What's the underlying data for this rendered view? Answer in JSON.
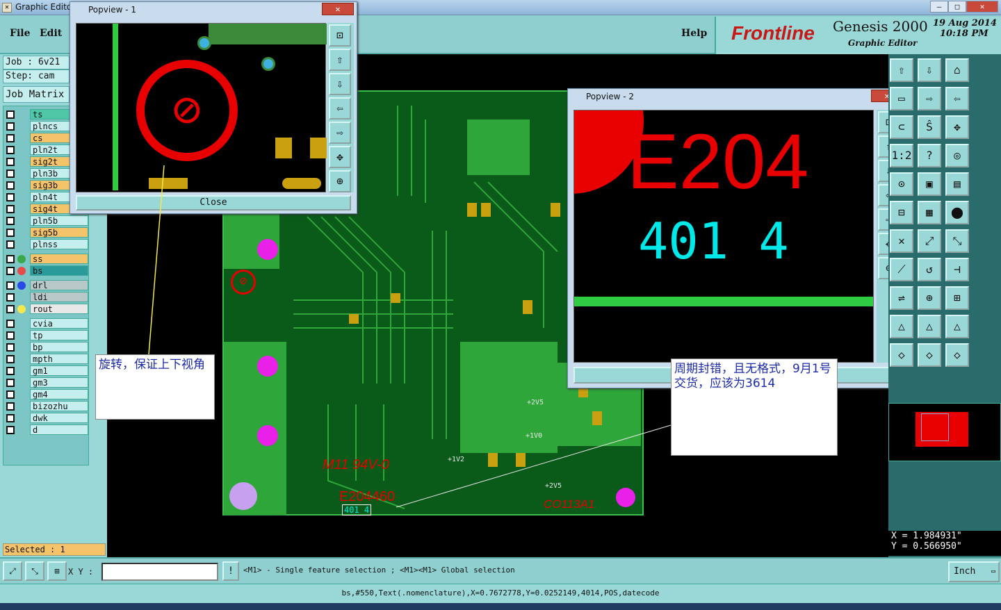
{
  "window": {
    "title": "Graphic Editor",
    "btn_min": "—",
    "btn_max": "□",
    "btn_close": "✕"
  },
  "menu": {
    "file": "File",
    "edit": "Edit",
    "help": "Help"
  },
  "brand": {
    "logo": "Frontline",
    "product": "Genesis 2000",
    "subtitle": "Graphic Editor",
    "date": "19 Aug 2014",
    "time": "10:18 PM"
  },
  "job": {
    "job_label": "Job : 6v21",
    "step_label": "Step: cam",
    "matrix_label": "Job Matrix"
  },
  "layers": [
    {
      "name": "ts",
      "color": "#4fc8a8"
    },
    {
      "name": "plncs",
      "color": "#c5efef"
    },
    {
      "name": "cs",
      "color": "#f5c46a"
    },
    {
      "name": "pln2t",
      "color": "#c5efef"
    },
    {
      "name": "sig2t",
      "color": "#f5c46a"
    },
    {
      "name": "pln3b",
      "color": "#c5efef"
    },
    {
      "name": "sig3b",
      "color": "#f5c46a"
    },
    {
      "name": "pln4t",
      "color": "#c5efef"
    },
    {
      "name": "sig4t",
      "color": "#f5c46a"
    },
    {
      "name": "pln5b",
      "color": "#c5efef"
    },
    {
      "name": "sig5b",
      "color": "#f5c46a"
    },
    {
      "name": "plnss",
      "color": "#c5efef"
    },
    {
      "name": "ss",
      "color": "#f5c46a",
      "dot": "#3aa84a"
    },
    {
      "name": "bs",
      "color": "#2a9a9a",
      "dot": "#e84a4a"
    },
    {
      "name": "drl",
      "color": "#b8c8c8",
      "dot": "#2a4ae8"
    },
    {
      "name": "ldi",
      "color": "#b8c8c8"
    },
    {
      "name": "rout",
      "color": "#e8e8e8",
      "dot": "#f5e84a"
    },
    {
      "name": "cvia",
      "color": "#c5efef"
    },
    {
      "name": "tp",
      "color": "#c5efef"
    },
    {
      "name": "bp",
      "color": "#c5efef"
    },
    {
      "name": "mpth",
      "color": "#c5efef"
    },
    {
      "name": "gm1",
      "color": "#c5efef"
    },
    {
      "name": "gm3",
      "color": "#c5efef"
    },
    {
      "name": "gm4",
      "color": "#c5efef"
    },
    {
      "name": "bizozhu",
      "color": "#c5efef"
    },
    {
      "name": "dwk",
      "color": "#c5efef"
    },
    {
      "name": "d",
      "color": "#c5efef"
    }
  ],
  "selected": "Selected : 1",
  "popup1": {
    "title": "Popview - 1",
    "close": "Close"
  },
  "popup2": {
    "title": "Popview - 2",
    "big_text": "E204",
    "cyan_text": "401 4"
  },
  "board": {
    "silk_ul": "M11 94V-0",
    "silk_code": "E204460",
    "silk_bottom": "CO113A1",
    "label_2v5a": "+2V5",
    "label_1v0": "+1V0",
    "label_1v2": "+1V2",
    "label_2v5b": "+2V5",
    "date_code": "401 4"
  },
  "notes": {
    "note1": "旋转，保证上下视角",
    "note2": "周期封错，且无格式，9月1号交货，应该为3614"
  },
  "coords": {
    "x": "X = 1.984931\"",
    "y": "Y = 0.566950\""
  },
  "bottom": {
    "xy_label": "X Y :",
    "xy_value": "",
    "hint": "<M1> - Single feature selection ; <M1><M1> Global selection",
    "units": "Inch"
  },
  "status": "bs,#550,Text(.nomenclature),X=0.7672778,Y=0.0252149,4014,POS,datecode",
  "colors": {
    "accent": "#9ad8d8",
    "board": "#0a5a1a",
    "copper": "#c8a010",
    "silk": "#e80000",
    "selection": "#00e8e8"
  }
}
